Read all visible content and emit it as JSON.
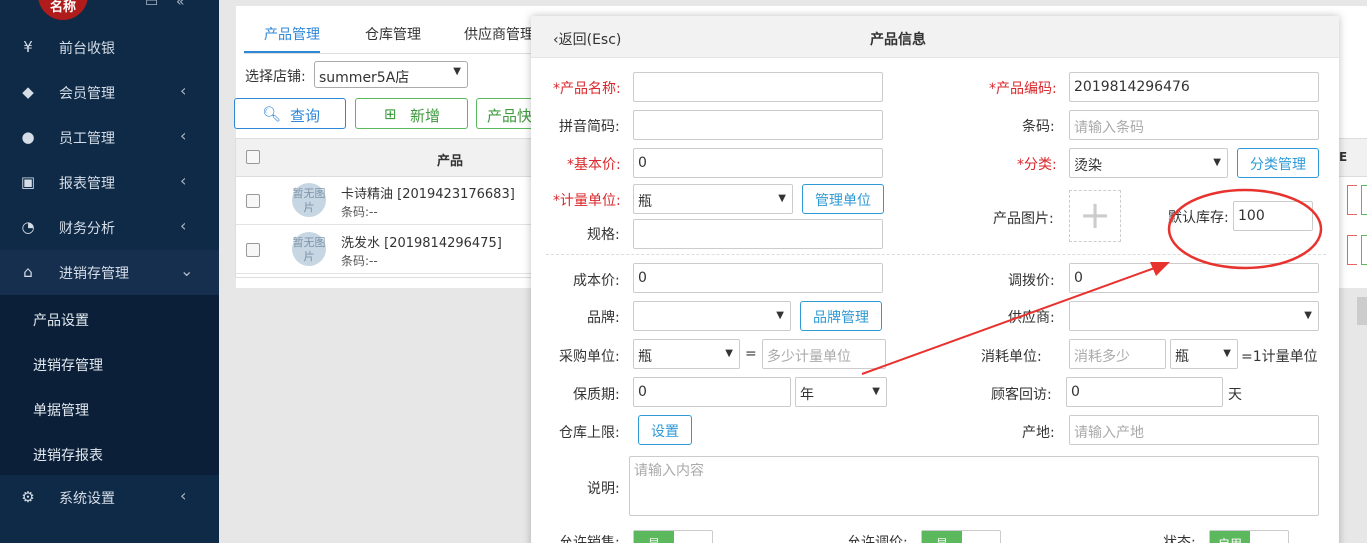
{
  "sidebar": {
    "logo": "名称",
    "items": [
      {
        "label": "前台收银",
        "icon": "yen-icon",
        "glyph": "¥"
      },
      {
        "label": "会员管理",
        "icon": "diamond-icon",
        "glyph": "◆"
      },
      {
        "label": "员工管理",
        "icon": "user-icon",
        "glyph": "●"
      },
      {
        "label": "报表管理",
        "icon": "monitor-icon",
        "glyph": "▣"
      },
      {
        "label": "财务分析",
        "icon": "pie-chart-icon",
        "glyph": "◔"
      },
      {
        "label": "进销存管理",
        "icon": "home-icon",
        "glyph": "⌂"
      },
      {
        "label": "系统设置",
        "icon": "gear-icon",
        "glyph": "⚙"
      }
    ],
    "subitems": [
      "产品设置",
      "进销存管理",
      "单据管理",
      "进销存报表"
    ]
  },
  "page": {
    "tabs": [
      "产品管理",
      "仓库管理",
      "供应商管理"
    ],
    "store_label": "选择店铺:",
    "store_value": "summer5A店",
    "buttons": {
      "query": "查询",
      "add": "新增",
      "quick": "产品快"
    },
    "table_header": "产品",
    "rows": [
      {
        "thumb": "暂无图片",
        "name": "卡诗精油 [2019423176683]",
        "sub": "条码:--"
      },
      {
        "thumb": "暂无图片",
        "name": "洗发水 [2019814296475]",
        "sub": "条码:--"
      }
    ],
    "col_e": "E"
  },
  "modal": {
    "back": "返回(Esc)",
    "title": "产品信息",
    "fields": {
      "name_label": "*产品名称:",
      "name_value": "",
      "code_label": "*产品编码:",
      "code_value": "2019814296476",
      "pinyin_label": "拼音简码:",
      "pinyin_value": "",
      "barcode_label": "条码:",
      "barcode_placeholder": "请输入条码",
      "price_label": "*基本价:",
      "price_value": "0",
      "category_label": "*分类:",
      "category_value": "烫染",
      "category_btn": "分类管理",
      "unit_label": "*计量单位:",
      "unit_value": "瓶",
      "unit_btn": "管理单位",
      "image_label": "产品图片:",
      "stock_label": "默认库存:",
      "stock_value": "100",
      "spec_label": "规格:",
      "spec_value": "",
      "cost_label": "成本价:",
      "cost_value": "0",
      "transfer_label": "调拨价:",
      "transfer_value": "0",
      "brand_label": "品牌:",
      "brand_value": "",
      "brand_btn": "品牌管理",
      "supplier_label": "供应商:",
      "supplier_value": "",
      "purchase_label": "采购单位:",
      "purchase_value": "瓶",
      "eq": "=",
      "purchase_placeholder": "多少计量单位",
      "consume_label": "消耗单位:",
      "consume_placeholder": "消耗多少",
      "consume_value": "瓶",
      "consume_suffix": "=1计量单位",
      "shelf_label": "保质期:",
      "shelf_value": "0",
      "shelf_unit": "年",
      "revisit_label": "顾客回访:",
      "revisit_value": "0",
      "revisit_unit": "天",
      "limit_label": "仓库上限:",
      "limit_btn": "设置",
      "origin_label": "产地:",
      "origin_placeholder": "请输入产地",
      "desc_label": "说明:",
      "desc_placeholder": "请输入内容",
      "sale_label": "允许销售:",
      "sale_value": "是",
      "adjust_label": "允许调价:",
      "adjust_value": "是",
      "status_label": "状态:",
      "status_value": "启用"
    }
  },
  "colors": {
    "accent": "#2f87d8",
    "required": "#d9282b",
    "annotation": "#e8322e",
    "toggle_on": "#5cb85c"
  }
}
